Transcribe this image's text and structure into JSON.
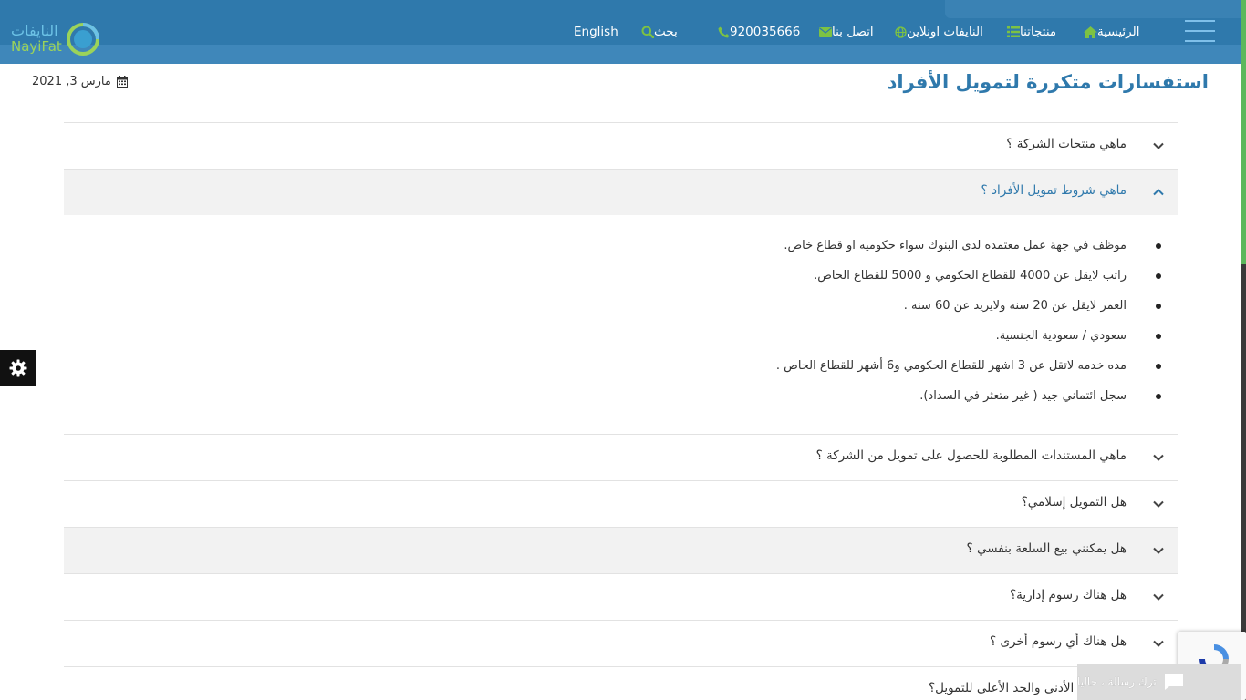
{
  "header": {
    "logo_ar": "النايفات",
    "logo_en": "NayiFat",
    "nav": {
      "home": "الرئيسية",
      "products": "منتجاتنا",
      "online": "النايفات اونلاين",
      "contact": "اتصل بنا",
      "phone": "920035666",
      "search": "بحث",
      "language": "English"
    },
    "colors": {
      "background": "#2f79ac",
      "icon_accent": "#7dc243"
    }
  },
  "page": {
    "title": "استفسارات متكررة لتمويل الأفراد",
    "date": "مارس 3, 2021"
  },
  "faq": {
    "q1": "ماهي منتجات الشركة ؟",
    "q2": "ماهي شروط تمويل الأفراد ؟",
    "q2_answers": [
      "موظف في جهة عمل  معتمده  لدى البنوك سواء حكوميه او قطاع خاص.",
      "راتب لايقل عن 4000 للقطاع  الحكومي و 5000 للقطاع  الخاص.",
      "العمر لايقل عن 20 سنه ولايزيد  عن 60 سنه .",
      "سعودي / سعودية الجنسية.",
      "مده خدمه لاتقل عن 3 اشهر للقطاع الحكومي و6 أشهر للقطاع الخاص .",
      "سجل ائتماني جيد ( غير متعثر في  السداد)."
    ],
    "q3": "ماهي المستندات المطلوبة للحصول على تمويل من الشركة ؟",
    "q4": "هل التمويل إسلامي؟",
    "q5": "هل يمكنني بيع السلعة بنفسي ؟",
    "q6": "هل هناك رسوم إدارية؟",
    "q7": "هل هناك أي رسوم أخرى ؟",
    "q8": "ماهو الحد الأدنى والحد الأعلى للتمويل؟"
  },
  "chat": {
    "label": "ترك رسالة ، حاليا"
  }
}
